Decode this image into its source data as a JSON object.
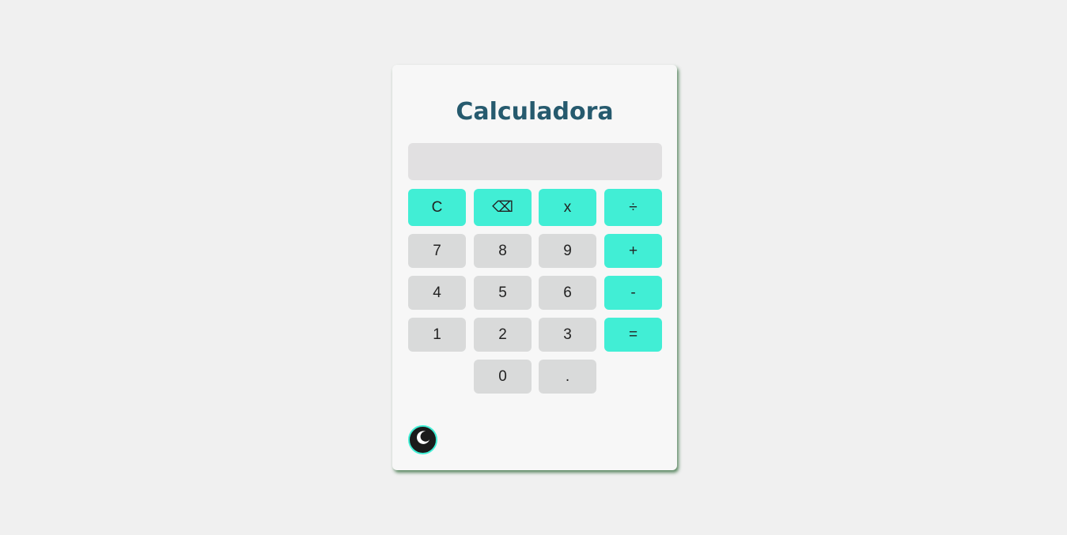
{
  "app": {
    "title": "Calculadora"
  },
  "display": {
    "value": ""
  },
  "keys": {
    "clear": "C",
    "backspace": "⌫",
    "multiply": "x",
    "divide": "÷",
    "seven": "7",
    "eight": "8",
    "nine": "9",
    "plus": "+",
    "four": "4",
    "five": "5",
    "six": "6",
    "minus": "-",
    "one": "1",
    "two": "2",
    "three": "3",
    "equals": "=",
    "zero": "0",
    "decimal": "."
  },
  "theme_toggle": {
    "icon": "moon-icon"
  },
  "colors": {
    "accent": "#41eed5",
    "title": "#265a6e",
    "number_key": "#d9dada",
    "display_bg": "#e1e0e1",
    "card_bg": "#f7f7f7",
    "page_bg": "#f0f0f0"
  }
}
